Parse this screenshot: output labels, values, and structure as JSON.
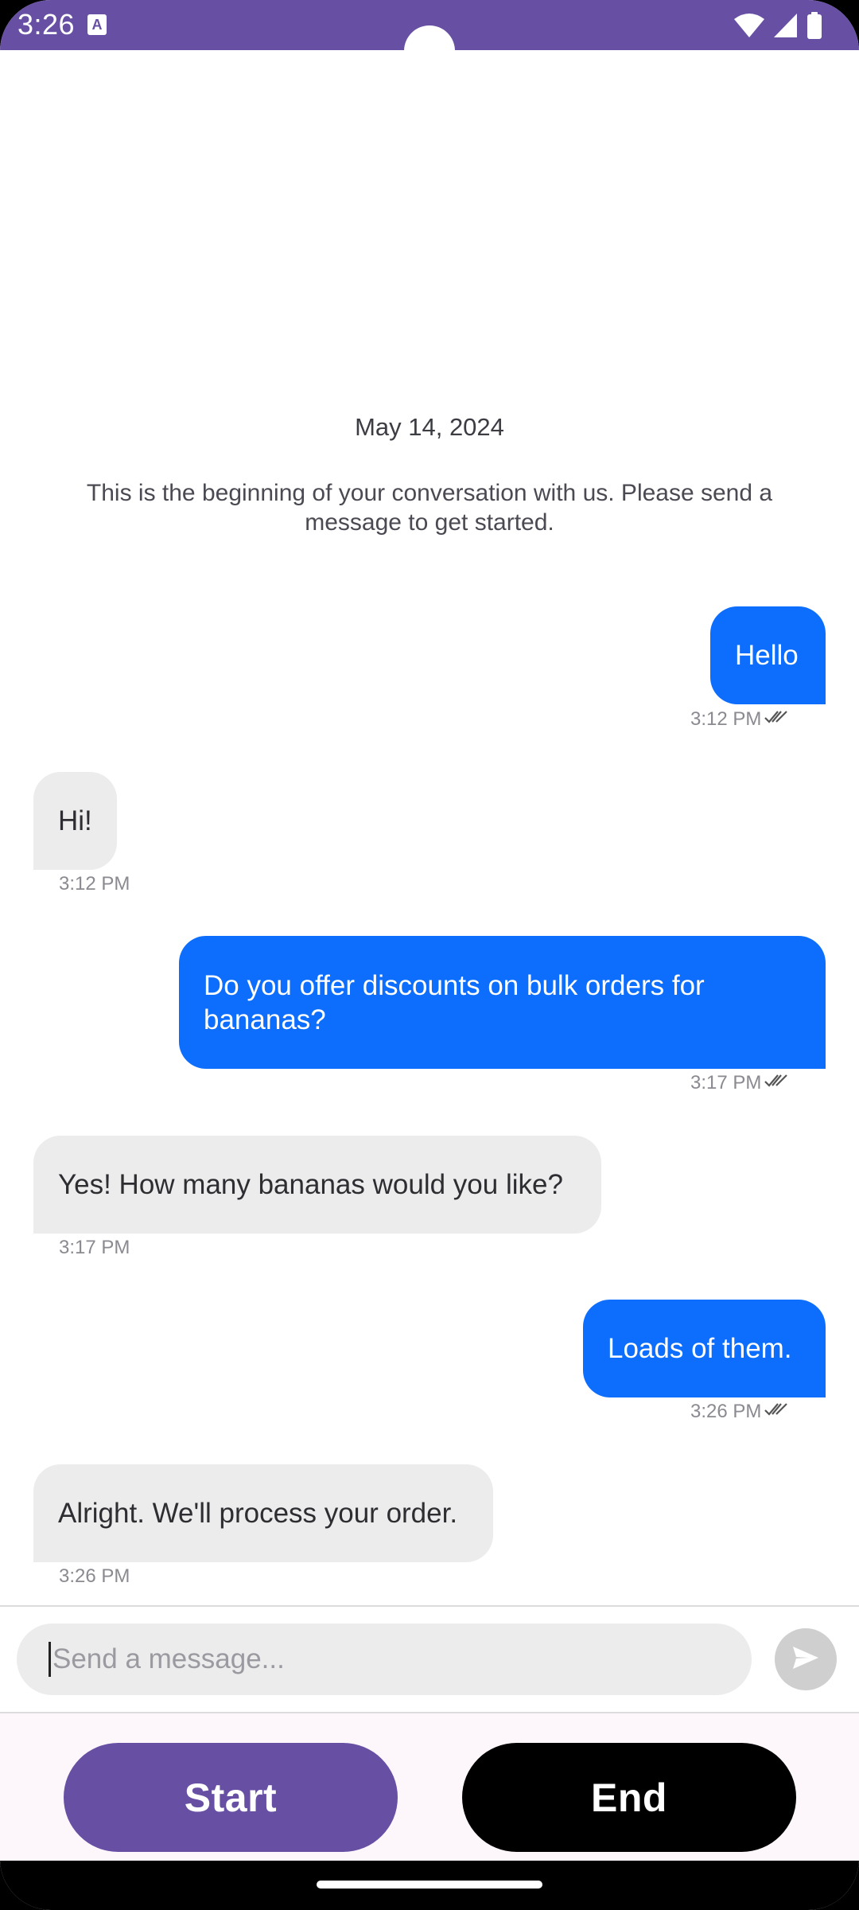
{
  "status_bar": {
    "time": "3:26",
    "notification_icon": "A",
    "icons": [
      "wifi-icon",
      "signal-icon",
      "battery-icon"
    ]
  },
  "chat": {
    "date": "May 14, 2024",
    "intro": "This is the beginning of your conversation with us. Please send a message to get started.",
    "messages": [
      {
        "direction": "outgoing",
        "text": "Hello",
        "time": "3:12 PM",
        "status": "read"
      },
      {
        "direction": "incoming",
        "text": "Hi!",
        "time": "3:12 PM"
      },
      {
        "direction": "outgoing",
        "text": "Do you offer discounts on bulk orders for bananas?",
        "time": "3:17 PM",
        "status": "read"
      },
      {
        "direction": "incoming",
        "text": "Yes! How many bananas would you like?",
        "time": "3:17 PM"
      },
      {
        "direction": "outgoing",
        "text": "Loads of them.",
        "time": "3:26 PM",
        "status": "read"
      },
      {
        "direction": "incoming",
        "text": "Alright. We'll process your order.",
        "time": "3:26 PM"
      }
    ]
  },
  "composer": {
    "placeholder": "Send a message...",
    "send_icon": "send-icon"
  },
  "actions": {
    "start_label": "Start",
    "end_label": "End"
  },
  "colors": {
    "status_bar": "#6750a4",
    "outgoing_bubble": "#0d6efd",
    "incoming_bubble": "#ececec",
    "start_button": "#6750a4",
    "end_button": "#000000"
  }
}
